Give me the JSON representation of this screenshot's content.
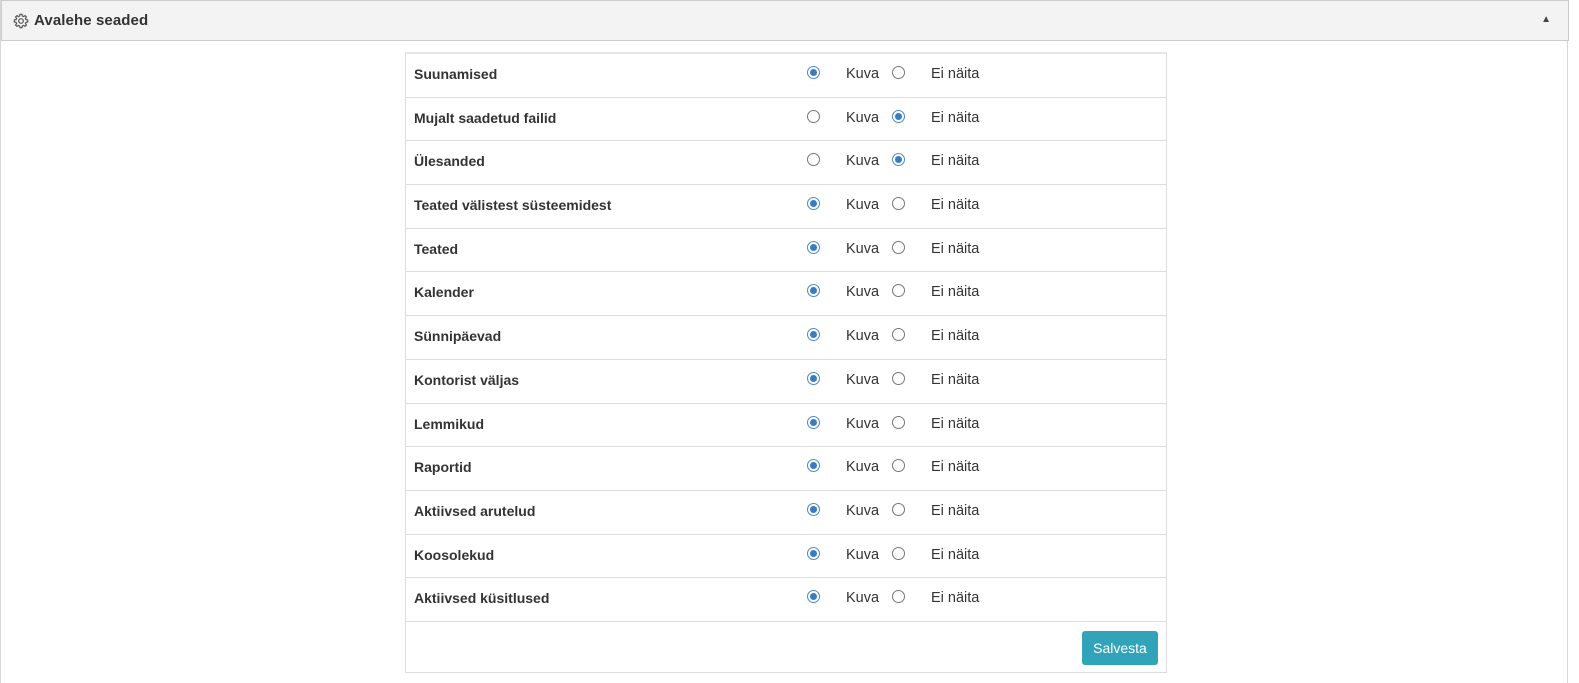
{
  "header": {
    "title": "Avalehe seaded",
    "icon": "gear-icon",
    "collapse_glyph": "▲"
  },
  "options": {
    "show_label": "Kuva",
    "hide_label": "Ei näita"
  },
  "settings": [
    {
      "label": "Suunamised",
      "selected": "show"
    },
    {
      "label": "Mujalt saadetud failid",
      "selected": "hide"
    },
    {
      "label": "Ülesanded",
      "selected": "hide"
    },
    {
      "label": "Teated välistest süsteemidest",
      "selected": "show"
    },
    {
      "label": "Teated",
      "selected": "show"
    },
    {
      "label": "Kalender",
      "selected": "show"
    },
    {
      "label": "Sünnipäevad",
      "selected": "show"
    },
    {
      "label": "Kontorist väljas",
      "selected": "show"
    },
    {
      "label": "Lemmikud",
      "selected": "show"
    },
    {
      "label": "Raportid",
      "selected": "show"
    },
    {
      "label": "Aktiivsed arutelud",
      "selected": "show"
    },
    {
      "label": "Koosolekud",
      "selected": "show"
    },
    {
      "label": "Aktiivsed küsitlused",
      "selected": "show"
    }
  ],
  "save_label": "Salvesta",
  "colors": {
    "accent": "#31a4b9",
    "radio_checked": "#3b7bbf",
    "header_bg": "#f3f3f3"
  }
}
